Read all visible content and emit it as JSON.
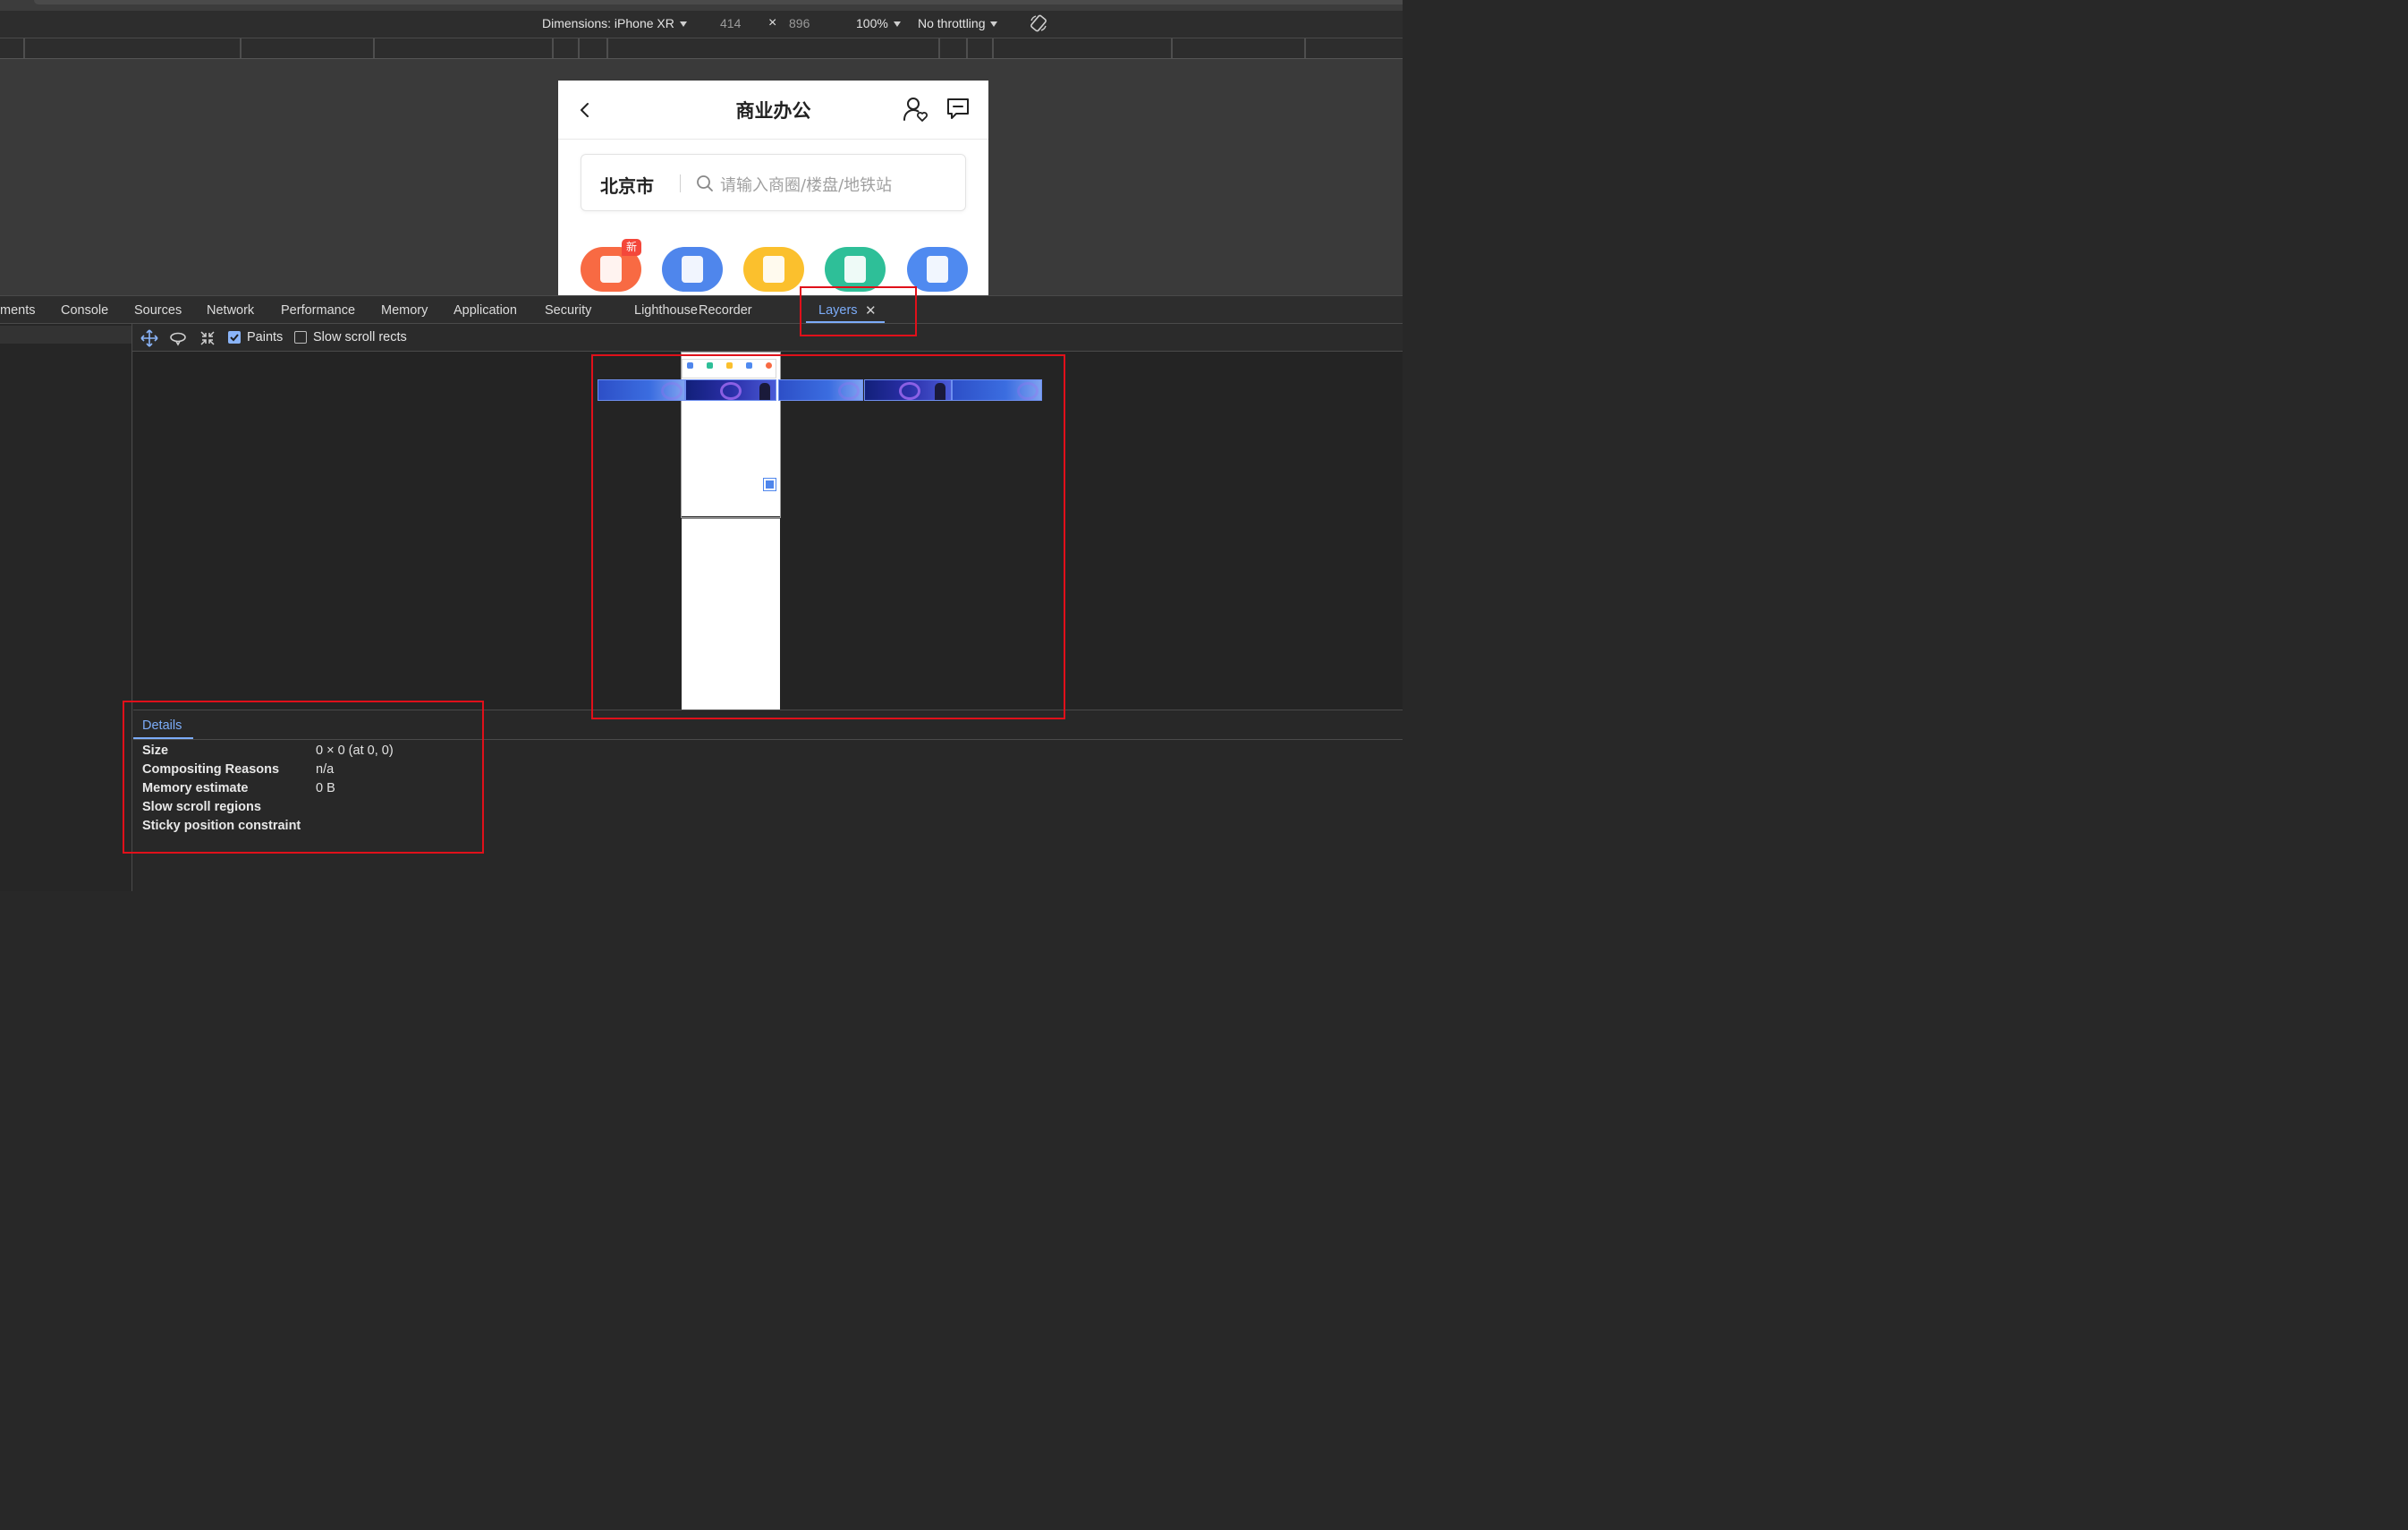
{
  "device_toolbar": {
    "dimensions_label": "Dimensions: iPhone XR",
    "width": "414",
    "times": "×",
    "height": "896",
    "zoom": "100%",
    "throttling": "No throttling"
  },
  "phone": {
    "title": "商业办公",
    "city": "北京市",
    "search_placeholder": "请输入商圈/楼盘/地铁站",
    "new_badge": "新",
    "category_colors": [
      "#f86a43",
      "#4f86ec",
      "#fbc02d",
      "#2ebf98",
      "#4f8af0"
    ]
  },
  "panel_tabs": [
    {
      "label": "ments",
      "active": false
    },
    {
      "label": "Console",
      "active": false
    },
    {
      "label": "Sources",
      "active": false
    },
    {
      "label": "Network",
      "active": false
    },
    {
      "label": "Performance",
      "active": false
    },
    {
      "label": "Memory",
      "active": false
    },
    {
      "label": "Application",
      "active": false
    },
    {
      "label": "Security",
      "active": false
    },
    {
      "label": "Lighthouse",
      "active": false
    },
    {
      "label": "Recorder",
      "active": false
    },
    {
      "label": "Layers",
      "active": true
    }
  ],
  "layers_toolbar": {
    "paints_label": "Paints",
    "paints_checked": true,
    "slow_scroll_label": "Slow scroll rects",
    "slow_scroll_checked": false
  },
  "details": {
    "tab_label": "Details",
    "rows": [
      {
        "key": "Size",
        "value": "0 × 0 (at 0, 0)"
      },
      {
        "key": "Compositing Reasons",
        "value": "n/a"
      },
      {
        "key": "Memory estimate",
        "value": "0 B"
      },
      {
        "key": "Slow scroll regions",
        "value": ""
      },
      {
        "key": "Sticky position constraint",
        "value": ""
      }
    ]
  },
  "colors": {
    "accent": "#7cacf8",
    "highlight": "#e0101a",
    "panel_bg": "#282828"
  }
}
